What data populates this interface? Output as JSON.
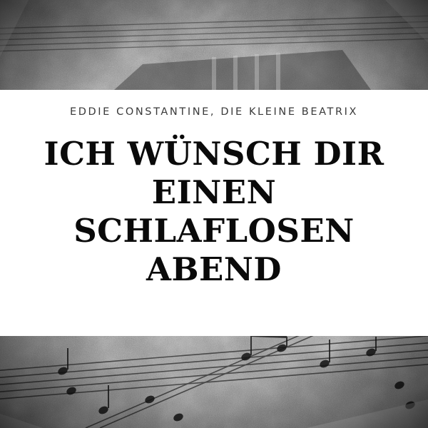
{
  "cover": {
    "artist": "EDDIE CONSTANTINE, DIE KLEINE BEATRIX",
    "title": "ICH WÜNSCH DIR EINEN SCHLAFLOSEN ABEND"
  }
}
